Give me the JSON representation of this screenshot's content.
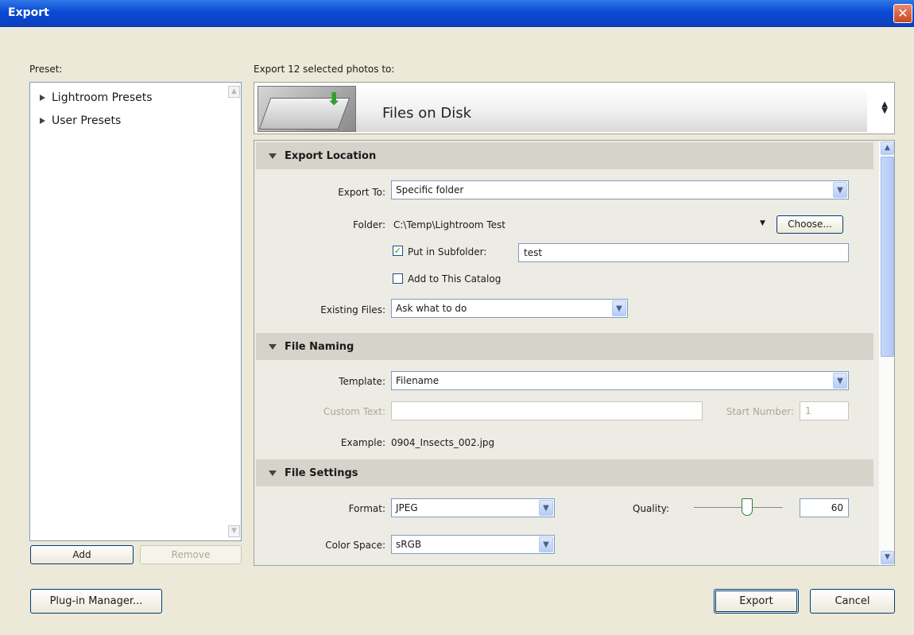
{
  "window": {
    "title": "Export"
  },
  "preset": {
    "label": "Preset:",
    "items": [
      {
        "label": "Lightroom Presets"
      },
      {
        "label": "User Presets"
      }
    ],
    "add_label": "Add",
    "remove_label": "Remove"
  },
  "destination": {
    "label": "Export 12 selected photos to:",
    "selected": "Files on Disk"
  },
  "sections": {
    "export_location": {
      "title": "Export Location",
      "export_to_label": "Export To:",
      "export_to_value": "Specific folder",
      "folder_label": "Folder:",
      "folder_value": "C:\\Temp\\Lightroom Test",
      "choose_label": "Choose...",
      "put_in_subfolder_label": "Put in Subfolder:",
      "put_in_subfolder_checked": true,
      "subfolder_value": "test",
      "add_to_catalog_label": "Add to This Catalog",
      "add_to_catalog_checked": false,
      "existing_files_label": "Existing Files:",
      "existing_files_value": "Ask what to do"
    },
    "file_naming": {
      "title": "File Naming",
      "template_label": "Template:",
      "template_value": "Filename",
      "custom_text_label": "Custom Text:",
      "custom_text_value": "",
      "start_number_label": "Start Number:",
      "start_number_value": "1",
      "example_label": "Example:",
      "example_value": "0904_Insects_002.jpg"
    },
    "file_settings": {
      "title": "File Settings",
      "format_label": "Format:",
      "format_value": "JPEG",
      "quality_label": "Quality:",
      "quality_value": "60",
      "quality_fraction": 0.6,
      "color_space_label": "Color Space:",
      "color_space_value": "sRGB"
    }
  },
  "footer": {
    "plugin_manager_label": "Plug-in Manager...",
    "export_label": "Export",
    "cancel_label": "Cancel"
  }
}
